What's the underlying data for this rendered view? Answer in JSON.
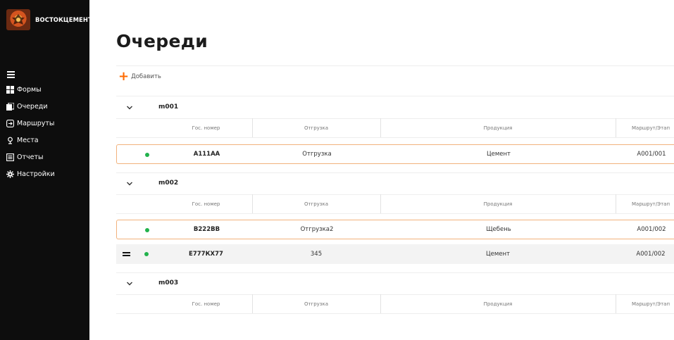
{
  "brand": {
    "name": "ВОСТОКЦЕМЕНТ"
  },
  "sidebar": {
    "items": [
      {
        "label": "Формы",
        "icon": "forms-grid-icon"
      },
      {
        "label": "Очереди",
        "icon": "queues-stack-icon"
      },
      {
        "label": "Маршруты",
        "icon": "routes-icon"
      },
      {
        "label": "Места",
        "icon": "places-pin-icon"
      },
      {
        "label": "Отчеты",
        "icon": "reports-icon"
      },
      {
        "label": "Настройки",
        "icon": "settings-gear-icon"
      }
    ]
  },
  "page": {
    "title": "Очереди",
    "add_label": "Добавить"
  },
  "columns": [
    "Гос. номер",
    "Отгрузка",
    "Продукция",
    "Маршрут/Этап"
  ],
  "groups": [
    {
      "name": "m001",
      "rows": [
        {
          "plate": "А111АА",
          "shipment": "Отгрузка",
          "product": "Цемент",
          "route": "A001/001",
          "status": "active"
        }
      ]
    },
    {
      "name": "m002",
      "rows": [
        {
          "plate": "В222ВВ",
          "shipment": "Отгрузка2",
          "product": "Щебень",
          "route": "A001/002",
          "status": "active"
        },
        {
          "plate": "Е777КХ77",
          "shipment": "345",
          "product": "Цемент",
          "route": "A001/002",
          "status": "active"
        }
      ]
    },
    {
      "name": "m003",
      "rows": []
    }
  ],
  "colors": {
    "accent": "#ff6a00",
    "sidebar_bg": "#0d0d0d",
    "status_active": "#22b24c",
    "selected_border": "#f2b27c"
  }
}
